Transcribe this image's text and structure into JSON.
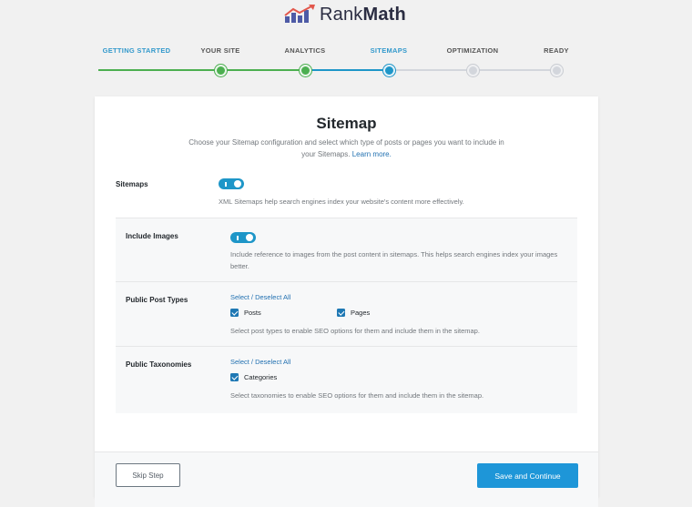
{
  "brand": {
    "name_part1": "Rank",
    "name_part2": "Math",
    "accent": "#4e5ba6"
  },
  "steps": [
    {
      "label": "GETTING STARTED",
      "state": "done"
    },
    {
      "label": "YOUR SITE",
      "state": "done"
    },
    {
      "label": "ANALYTICS",
      "state": "done"
    },
    {
      "label": "SITEMAPS",
      "state": "active"
    },
    {
      "label": "OPTIMIZATION",
      "state": "pending"
    },
    {
      "label": "READY",
      "state": "pending"
    }
  ],
  "card": {
    "title": "Sitemap",
    "description": "Choose your Sitemap configuration and select which type of posts or pages you want to include in your Sitemaps.",
    "learn_more": "Learn more."
  },
  "sitemaps": {
    "label": "Sitemaps",
    "enabled": true,
    "help": "XML Sitemaps help search engines index your website's content more effectively."
  },
  "include_images": {
    "label": "Include Images",
    "enabled": true,
    "help": "Include reference to images from the post content in sitemaps. This helps search engines index your images better."
  },
  "post_types": {
    "label": "Public Post Types",
    "select_all": "Select / Deselect All",
    "options": [
      {
        "label": "Posts",
        "checked": true
      },
      {
        "label": "Pages",
        "checked": true
      }
    ],
    "help": "Select post types to enable SEO options for them and include them in the sitemap."
  },
  "taxonomies": {
    "label": "Public Taxonomies",
    "select_all": "Select / Deselect All",
    "options": [
      {
        "label": "Categories",
        "checked": true
      }
    ],
    "help": "Select taxonomies to enable SEO options for them and include them in the sitemap."
  },
  "footer": {
    "skip_label": "Skip Step",
    "continue_label": "Save and Continue"
  },
  "colors": {
    "done": "#4caf50",
    "active": "#1e96c8",
    "pending": "#c9ccd2",
    "primary_button": "#1e96d8"
  }
}
